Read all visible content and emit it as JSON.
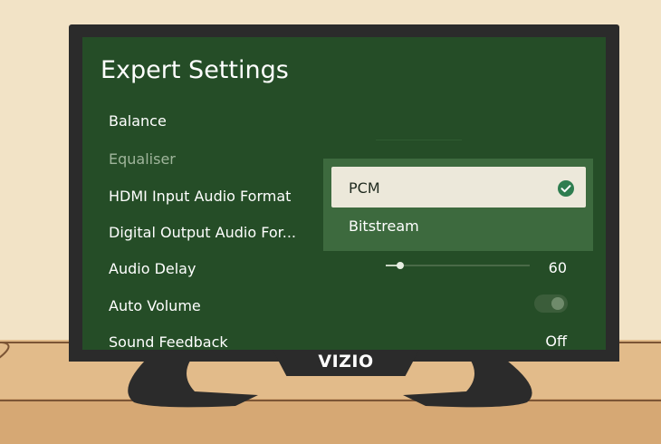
{
  "screen": {
    "title": "Expert Settings",
    "menu_items": [
      {
        "label": "Balance"
      },
      {
        "label": "Equaliser"
      },
      {
        "label": "HDMI Input Audio Format"
      },
      {
        "label": "Digital Output Audio For..."
      },
      {
        "label": "Audio Delay",
        "value": "60"
      },
      {
        "label": "Auto Volume",
        "toggle_on": false
      },
      {
        "label": "Sound Feedback",
        "value": "Off"
      }
    ],
    "audio_delay_level": 0.1,
    "dropdown": {
      "options": [
        {
          "label": "PCM",
          "selected": true
        },
        {
          "label": "Bitstream",
          "selected": false
        }
      ]
    }
  },
  "tv": {
    "brand": "VIZIO"
  },
  "colors": {
    "screen_bg": "#254d27",
    "dropdown_bg": "#3d6a3e",
    "selected_option_bg": "#ece8da",
    "check_green": "#2e7d4f"
  }
}
